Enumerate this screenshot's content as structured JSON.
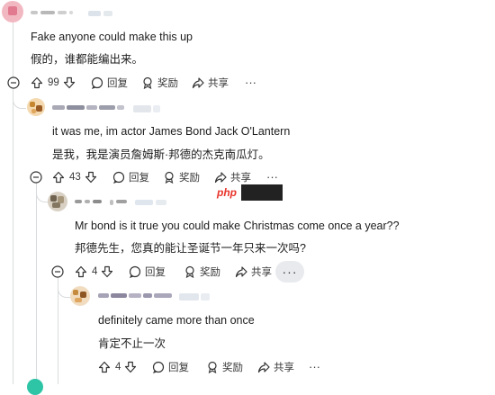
{
  "comments": [
    {
      "body_en": "Fake anyone could make this up",
      "body_zh": "假的，谁都能编出来。",
      "votes": "99",
      "reply_label": "回复",
      "award_label": "奖励",
      "share_label": "共享",
      "more_label": "···"
    },
    {
      "body_en": "it was me, im actor James Bond Jack O'Lantern",
      "body_zh": "是我，我是演员詹姆斯·邦德的杰克南瓜灯。",
      "votes": "43",
      "reply_label": "回复",
      "award_label": "奖励",
      "share_label": "共享",
      "more_label": "···"
    },
    {
      "body_en": "Mr bond is it true you could make Christmas come once a year??",
      "body_zh": "邦德先生，您真的能让圣诞节一年只来一次吗?",
      "votes": "4",
      "reply_label": "回复",
      "award_label": "奖励",
      "share_label": "共享",
      "more_label": "···"
    },
    {
      "body_en": "definitely came more than once",
      "body_zh": "肯定不止一次",
      "votes": "4",
      "reply_label": "回复",
      "award_label": "奖励",
      "share_label": "共享",
      "more_label": "···"
    }
  ],
  "watermark": {
    "text": "php"
  },
  "colors": {
    "accent": "#e8352c",
    "line": "#d8dadc",
    "pill": "#e8eaed"
  }
}
